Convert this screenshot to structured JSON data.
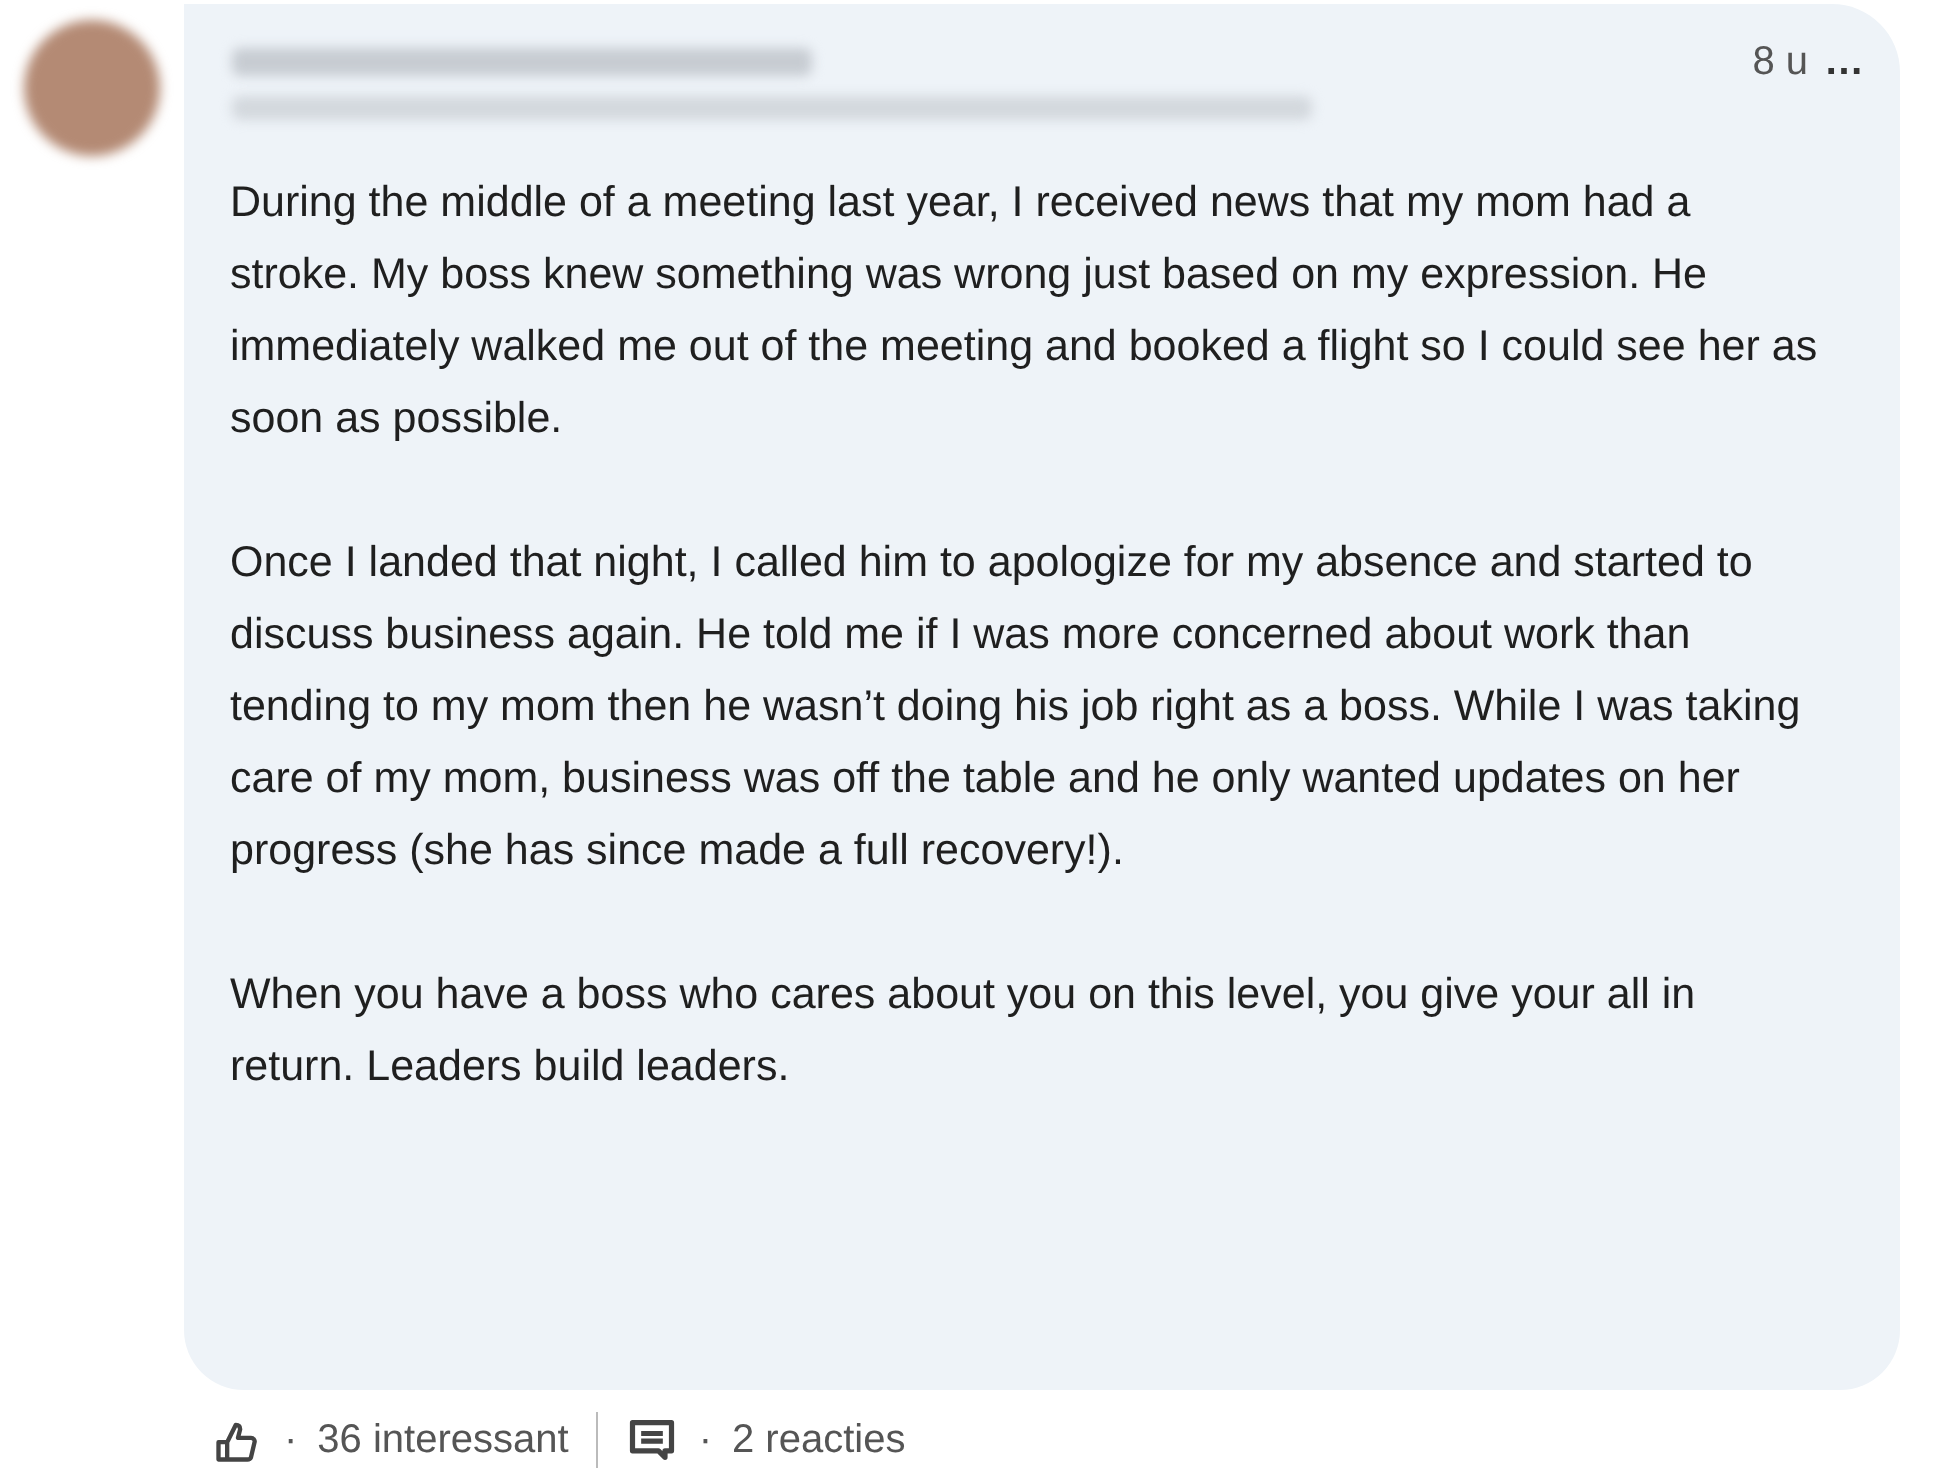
{
  "comment": {
    "time": "8 u",
    "more": "…",
    "paragraphs": [
      "During the middle of a meeting last year, I received news that my mom had a stroke. My boss knew something was wrong just based on my expression. He immediately walked me out of the meeting and booked a flight so I could see her as soon as possible.",
      "Once I landed that night, I called him to apologize for my absence and started to discuss business again. He told me if I was more concerned about work than tending to my mom then he wasn’t doing his job right as a boss. While I was taking care of my mom, business was off the table and he only wanted updates on her progress (she has since made a full recovery!).",
      "When you have a boss who cares about you on this level, you give your all in return. Leaders build leaders."
    ]
  },
  "footer": {
    "reactions": [
      {
        "kind": "like",
        "separator": "·",
        "label": "36 interessant"
      },
      {
        "kind": "comment",
        "separator": "·",
        "label": "2 reacties"
      }
    ]
  }
}
